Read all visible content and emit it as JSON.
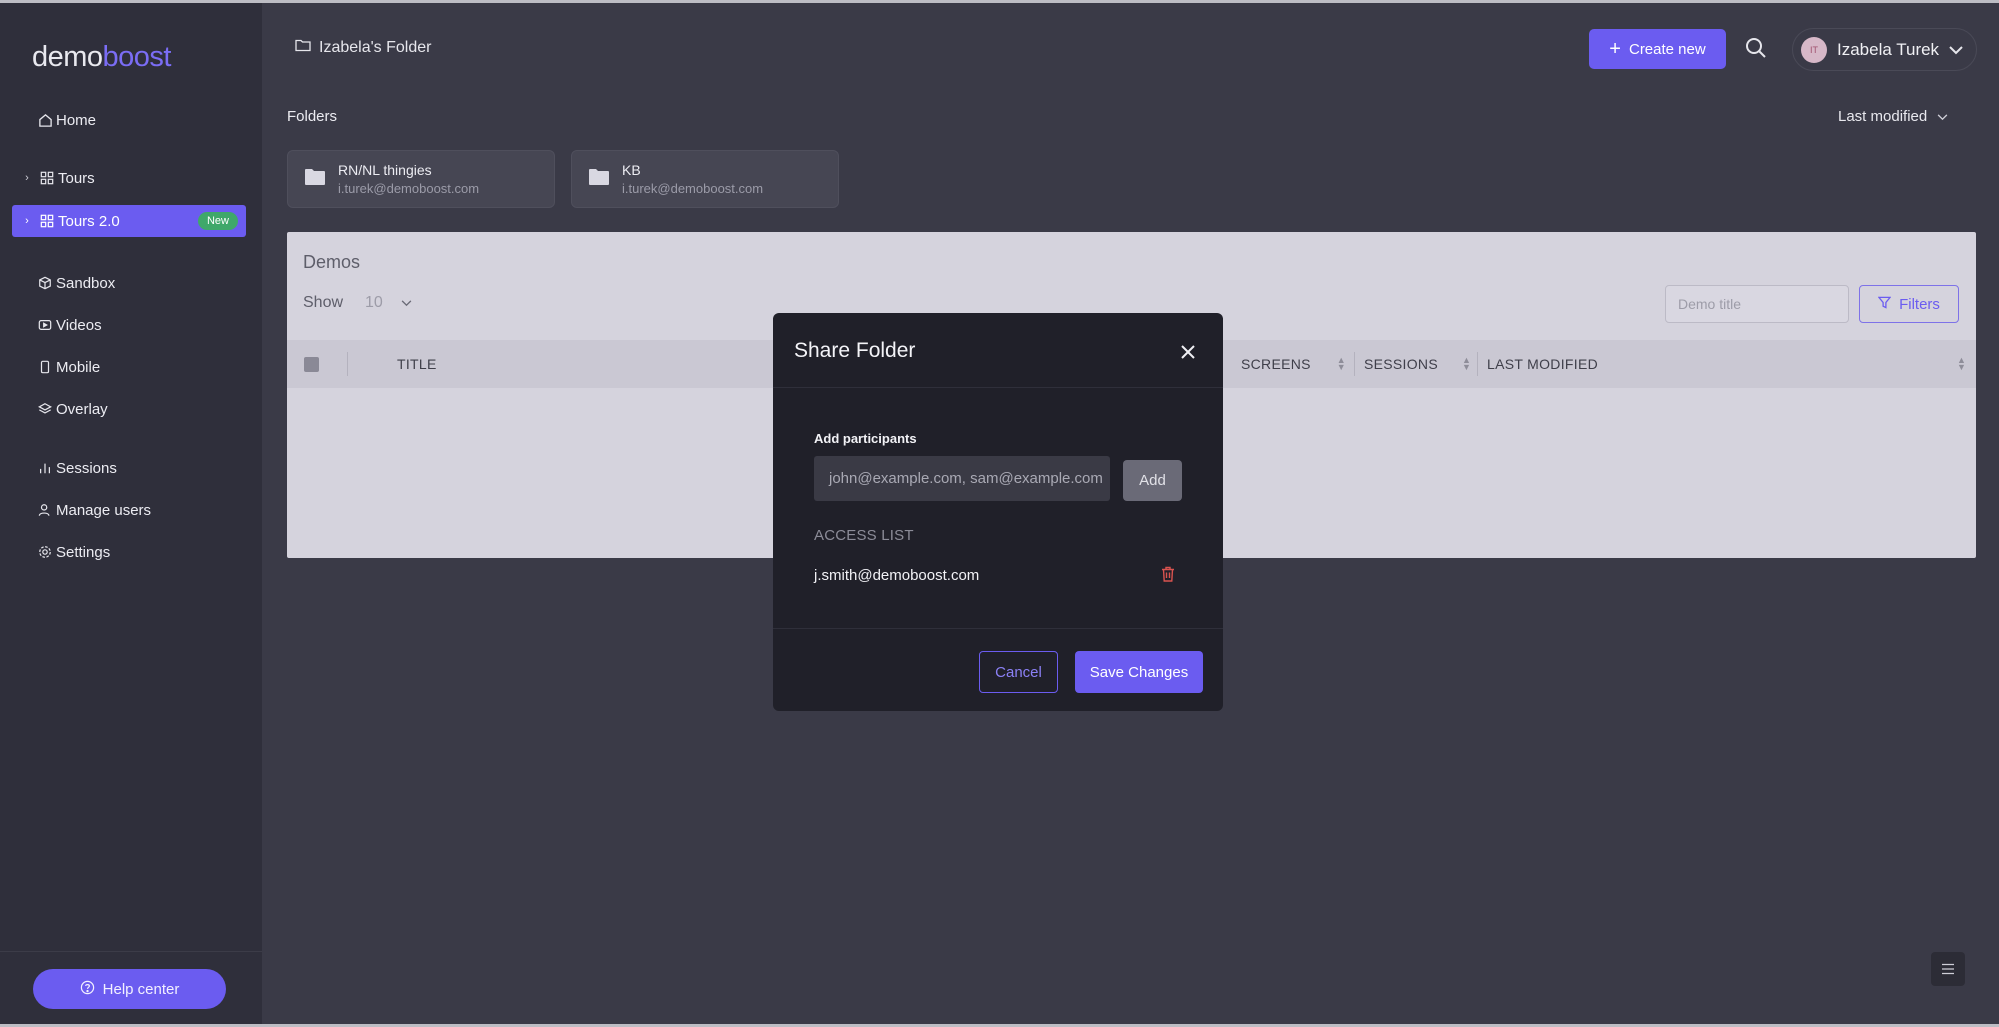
{
  "logo": {
    "part1": "demo",
    "part2": "boost"
  },
  "sidebar": {
    "items": [
      {
        "label": "Home",
        "icon": "home-icon"
      },
      {
        "label": "Tours",
        "icon": "grid-icon"
      },
      {
        "label": "Tours 2.0",
        "icon": "grid-icon",
        "badge": "New"
      },
      {
        "label": "Sandbox",
        "icon": "cube-icon"
      },
      {
        "label": "Videos",
        "icon": "video-icon"
      },
      {
        "label": "Mobile",
        "icon": "mobile-icon"
      },
      {
        "label": "Overlay",
        "icon": "layers-icon"
      },
      {
        "label": "Sessions",
        "icon": "bar-chart-icon"
      },
      {
        "label": "Manage users",
        "icon": "user-icon"
      },
      {
        "label": "Settings",
        "icon": "gear-icon"
      }
    ],
    "help": "Help center"
  },
  "header": {
    "breadcrumb": "Izabela's Folder",
    "create_label": "Create new",
    "user_name": "Izabela Turek",
    "user_initials": "IT"
  },
  "folders": {
    "title": "Folders",
    "sort_label": "Last modified",
    "items": [
      {
        "name": "RN/NL thingies",
        "owner": "i.turek@demoboost.com"
      },
      {
        "name": "KB",
        "owner": "i.turek@demoboost.com"
      }
    ]
  },
  "demos": {
    "title": "Demos",
    "show_label": "Show",
    "show_value": "10",
    "search_placeholder": "Demo title",
    "filters_label": "Filters",
    "columns": [
      "TITLE",
      "SCREENS",
      "SESSIONS",
      "LAST MODIFIED"
    ]
  },
  "modal": {
    "title": "Share Folder",
    "add_label": "Add participants",
    "input_placeholder": "john@example.com, sam@example.com",
    "add_button": "Add",
    "access_label": "ACCESS LIST",
    "access_list": [
      "j.smith@demoboost.com"
    ],
    "cancel": "Cancel",
    "save": "Save Changes"
  },
  "colors": {
    "accent": "#6b5cf0",
    "sidebar_bg": "#2f2f3b",
    "main_bg": "#3a3a47",
    "modal_bg": "#202029",
    "badge_green": "#3fa86a",
    "danger": "#d9534f"
  }
}
